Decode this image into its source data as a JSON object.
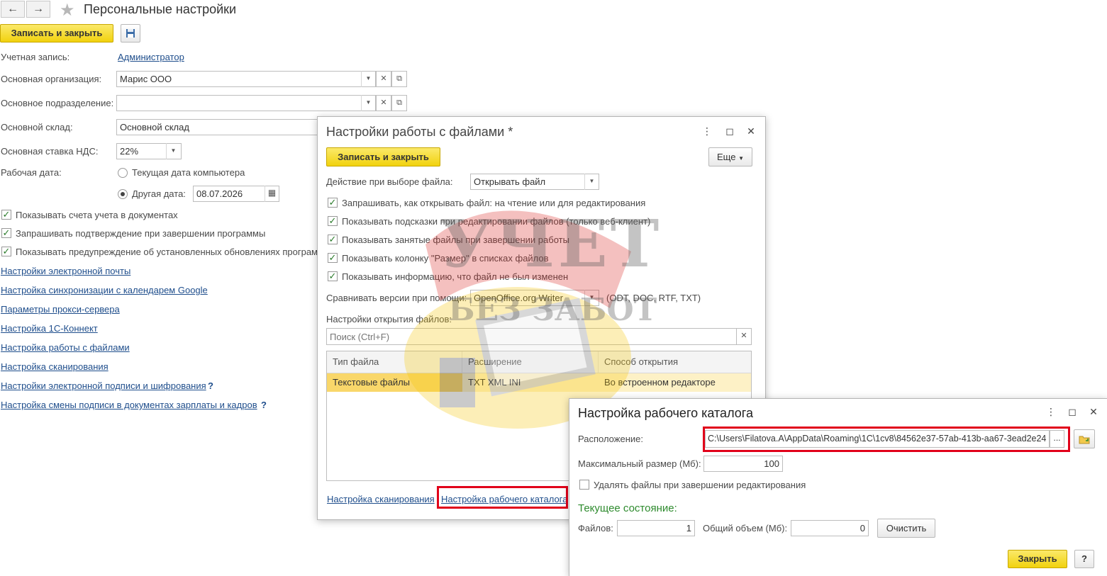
{
  "main": {
    "title": "Персональные настройки",
    "save_close": "Записать и закрыть",
    "account_label": "Учетная запись:",
    "account_value": "Администратор",
    "org_label": "Основная организация:",
    "org_value": "Марис ООО",
    "dept_label": "Основное подразделение:",
    "dept_value": "",
    "warehouse_label": "Основной склад:",
    "warehouse_value": "Основной склад",
    "vat_label": "Основная ставка НДС:",
    "vat_value": "22%",
    "workdate_label": "Рабочая дата:",
    "radio_computer": "Текущая дата компьютера",
    "radio_other": "Другая дата:",
    "other_date": "08.07.2026",
    "chk_accounts": "Показывать счета учета в документах",
    "chk_confirm_exit": "Запрашивать подтверждение при завершении программы",
    "chk_updates": "Показывать предупреждение об установленных обновлениях программы",
    "links": [
      "Настройки электронной почты",
      "Настройка синхронизации с календарем Google",
      "Параметры прокси-сервера",
      "Настройка 1С-Коннект",
      "Настройка работы с файлами",
      "Настройка сканирования",
      "Настройки электронной подписи и шифрования",
      "Настройка смены подписи в документах зарплаты и кадров"
    ],
    "help_mark": "?"
  },
  "files_dialog": {
    "title": "Настройки работы с файлами *",
    "save_close": "Записать и закрыть",
    "more": "Еще",
    "action_label": "Действие при выборе файла:",
    "action_value": "Открывать файл",
    "checks": [
      "Запрашивать, как открывать файл: на чтение или для редактирования",
      "Показывать подсказки при редактировании файлов (только веб-клиент)",
      "Показывать занятые файлы при завершении работы",
      "Показывать колонку \"Размер\" в списках файлов",
      "Показывать информацию, что файл не был изменен"
    ],
    "compare_label": "Сравнивать версии при помощи:",
    "compare_value": "OpenOffice.org Writer",
    "compare_hint": "(ODT, DOC, RTF, TXT)",
    "open_settings_label": "Настройки открытия файлов:",
    "search_placeholder": "Поиск (Ctrl+F)",
    "table": {
      "headers": [
        "Тип файла",
        "Расширение",
        "Способ открытия"
      ],
      "rows": [
        [
          "Текстовые файлы",
          "TXT XML INI",
          "Во встроенном редакторе"
        ]
      ]
    },
    "link_scan": "Настройка сканирования",
    "link_workdir": "Настройка рабочего каталога"
  },
  "workdir_dialog": {
    "title": "Настройка рабочего каталога",
    "location_label": "Расположение:",
    "location_value": "C:\\Users\\Filatova.A\\AppData\\Roaming\\1C\\1cv8\\84562e37-57ab-413b-aa67-3ead2e24",
    "ellipsis": "...",
    "maxsize_label": "Максимальный размер (Мб):",
    "maxsize_value": "100",
    "delete_label": "Удалять файлы при завершении редактирования",
    "state_header": "Текущее состояние:",
    "files_label": "Файлов:",
    "files_value": "1",
    "total_label": "Общий объем (Мб):",
    "total_value": "0",
    "clear_btn": "Очистить",
    "close_btn": "Закрыть",
    "help_btn": "?"
  },
  "watermark": {
    "line1": "УЧЕТ",
    "line2": "БЕЗ ЗАБОТ"
  },
  "colors": {
    "accent_yellow": "#f5d90f",
    "link_blue": "#1f4e8c",
    "highlight_red": "#e1001a",
    "state_green": "#2e8b2e",
    "row_highlight": "#fdf1c6"
  }
}
